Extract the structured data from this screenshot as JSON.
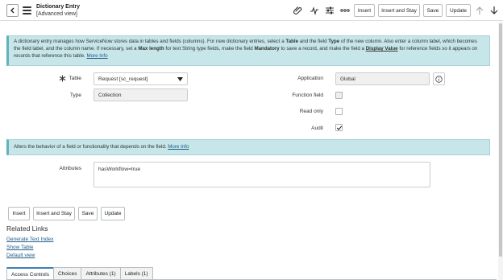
{
  "header": {
    "title": "Dictionary Entry",
    "subtitle": "[Advanced view]",
    "buttons": {
      "insert": "Insert",
      "insert_and_stay": "Insert and Stay",
      "save": "Save",
      "update": "Update"
    },
    "icons": [
      "back-icon",
      "menu-icon",
      "attachment-icon",
      "activity-icon",
      "settings-sliders-icon",
      "more-icon",
      "arrow-up-icon",
      "arrow-down-icon"
    ]
  },
  "info1": {
    "p1": "A dictionary entry manages how ServiceNow stores data in tables and fields (columns). For new dictionary entries, select a ",
    "b1": "Table",
    "p2": " and the field ",
    "b2": "Type",
    "p3": " of the new column. Also enter a column label, which becomes the field label, and the column name. If necessary, set a ",
    "b3": "Max length",
    "p4": " for text String type fields, make the field ",
    "b4": "Mandatory",
    "p5": " to save a record, and make the field a ",
    "b5": "Display Value",
    "p6": " for reference fields so it appears on records that reference this table. ",
    "link": "More Info"
  },
  "form": {
    "table_label": "Table",
    "table_value": "Request [sc_request]",
    "type_label": "Type",
    "type_value": "Collection",
    "application_label": "Application",
    "application_value": "Global",
    "function_field_label": "Function field",
    "read_only_label": "Read only",
    "audit_label": "Audit",
    "function_field_checked": false,
    "read_only_checked": false,
    "audit_checked": true
  },
  "info2": {
    "text": "Alters the behavior of a field or functionality that depends on the field. ",
    "link": "More Info"
  },
  "attributes": {
    "label": "Attributes",
    "value": "hasWorkflow=true"
  },
  "bottom_buttons": {
    "insert": "Insert",
    "insert_and_stay": "Insert and Stay",
    "save": "Save",
    "update": "Update"
  },
  "related_links": {
    "title": "Related Links",
    "links": [
      "Generate Text Index",
      "Show Table",
      "Default view"
    ]
  },
  "tabs": [
    "Access Controls",
    "Choices",
    "Attributes (1)",
    "Labels (1)"
  ],
  "colors": {
    "info_bg": "#c7e6e9",
    "link": "#1f5a86",
    "active_tab": "#3d7fb6"
  }
}
